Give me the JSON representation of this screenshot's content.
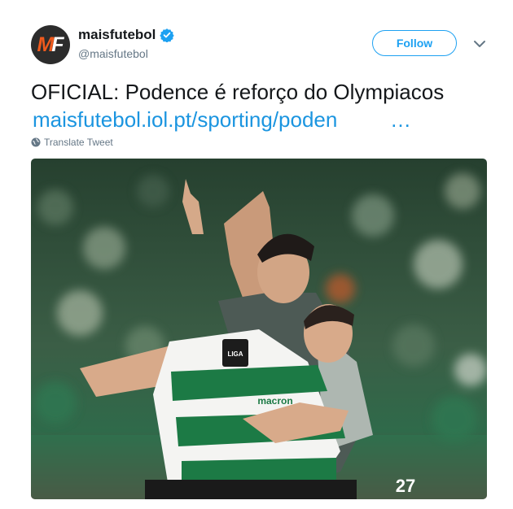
{
  "author": {
    "display_name": "maisfutebol",
    "handle": "@maisfutebol",
    "avatar_text_m": "M",
    "avatar_text_f": "F",
    "verified": true
  },
  "actions": {
    "follow_label": "Follow",
    "menu_icon": "chevron-down-icon"
  },
  "tweet": {
    "text": "OFICIAL: Podence é reforço do Olympiacos",
    "link_text": "maisfutebol.iol.pt/sporting/poden",
    "link_ellipsis": "…",
    "translate_label": "Translate Tweet"
  },
  "media": {
    "shirt_sponsor": "macron",
    "shirt_number": "27",
    "badge_text": "LIGA"
  },
  "colors": {
    "brand_orange": "#ef5a1d",
    "link_blue": "#1b95e0",
    "follow_blue": "#1da1f2",
    "sporting_green": "#1c7a45",
    "muted_gray": "#657786"
  }
}
